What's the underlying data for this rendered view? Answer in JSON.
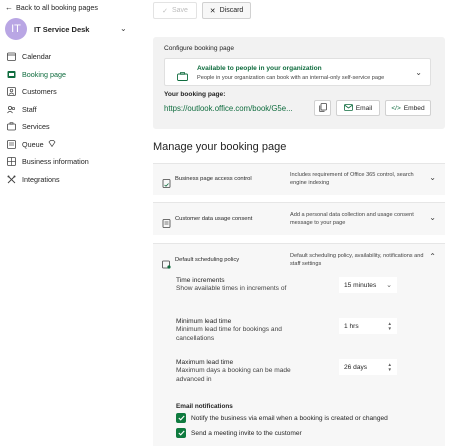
{
  "sidebar": {
    "back_label": "Back to all booking pages",
    "org_initials": "IT",
    "org_name": "IT Service Desk",
    "items": [
      {
        "label": "Calendar",
        "icon": "calendar-icon"
      },
      {
        "label": "Booking page",
        "icon": "booking-page-icon",
        "active": true
      },
      {
        "label": "Customers",
        "icon": "customers-icon"
      },
      {
        "label": "Staff",
        "icon": "staff-icon"
      },
      {
        "label": "Services",
        "icon": "services-icon"
      },
      {
        "label": "Queue",
        "icon": "queue-icon",
        "badge_icon": "diamond-icon"
      },
      {
        "label": "Business information",
        "icon": "business-info-icon"
      },
      {
        "label": "Integrations",
        "icon": "integrations-icon"
      }
    ]
  },
  "toolbar": {
    "save_label": "Save",
    "discard_label": "Discard"
  },
  "config": {
    "title": "Configure booking page",
    "availability_title": "Available to people in your organization",
    "availability_desc": "People in your organization can book with an internal-only self-service page",
    "your_booking_label": "Your booking page:",
    "url": "https://outlook.office.com/book/G5e...",
    "email_label": "Email",
    "embed_label": "Embed"
  },
  "manage": {
    "title": "Manage your booking page",
    "sections": [
      {
        "title": "Business page access control",
        "desc": "Includes requirement of Office 365 control, search engine indexing",
        "expanded": false
      },
      {
        "title": "Customer data usage consent",
        "desc": "Add a personal data collection and usage consent message to your page",
        "expanded": false
      },
      {
        "title": "Default scheduling policy",
        "desc": "Default scheduling policy, availability, notifications and staff settings",
        "expanded": true
      }
    ]
  },
  "policy": {
    "time_increments_label": "Time increments",
    "time_increments_desc": "Show available times in increments of",
    "time_increments_value": "15 minutes",
    "min_lead_label": "Minimum lead time",
    "min_lead_desc": "Minimum lead time for bookings and cancellations",
    "min_lead_value": "1 hrs",
    "max_lead_label": "Maximum lead time",
    "max_lead_desc": "Maximum days a booking can be made advanced in",
    "max_lead_value": "26 days",
    "email_notifications_label": "Email notifications",
    "notify_business_label": "Notify the business via email when a booking is created or changed",
    "notify_business_checked": true,
    "meeting_invite_label": "Send a meeting invite to the customer",
    "meeting_invite_checked": true
  },
  "colors": {
    "accent": "#0f6c3e",
    "avatar": "#b9a6e4",
    "checkbox": "#0f7b3f"
  }
}
